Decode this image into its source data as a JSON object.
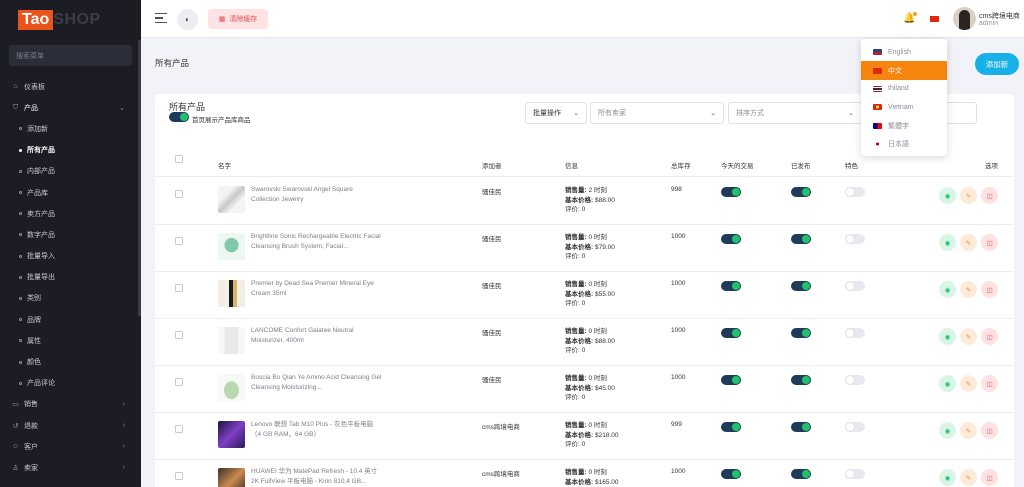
{
  "brand": {
    "part1": "Tao",
    "part2": "SHOP"
  },
  "sidebar": {
    "search_placeholder": "搜索菜单",
    "items": [
      {
        "label": "仪表板",
        "icon": "home-icon"
      },
      {
        "label": "产品",
        "icon": "cart-icon",
        "open": true
      },
      {
        "label": "添加新",
        "sub": true
      },
      {
        "label": "所有产品",
        "sub": true,
        "active": true
      },
      {
        "label": "内部产品",
        "sub": true
      },
      {
        "label": "产品库",
        "sub": true
      },
      {
        "label": "卖方产品",
        "sub": true
      },
      {
        "label": "数字产品",
        "sub": true
      },
      {
        "label": "批量导入",
        "sub": true
      },
      {
        "label": "批量导出",
        "sub": true
      },
      {
        "label": "类别",
        "sub": true
      },
      {
        "label": "品牌",
        "sub": true
      },
      {
        "label": "属性",
        "sub": true
      },
      {
        "label": "颜色",
        "sub": true
      },
      {
        "label": "产品评论",
        "sub": true
      },
      {
        "label": "销售",
        "icon": "money-icon",
        "chevron": true
      },
      {
        "label": "退款",
        "icon": "refund-icon",
        "chevron": true
      },
      {
        "label": "客户",
        "icon": "customer-icon",
        "chevron": true
      },
      {
        "label": "卖家",
        "icon": "seller-icon",
        "chevron": true
      }
    ]
  },
  "header": {
    "clear_cache_label": "清除缓存",
    "user_name": "cms跨境电商",
    "user_role": "admin"
  },
  "page": {
    "title": "所有产品",
    "add_button": "添加新"
  },
  "card": {
    "title": "所有产品",
    "toggle_label": "首页展示产品库商品",
    "bulk_action": "批量操作",
    "seller_placeholder": "所有卖家",
    "sort_placeholder": "排序方式"
  },
  "table": {
    "columns": {
      "name": "名字",
      "added_by": "添加者",
      "info": "信息",
      "stock": "总库存",
      "today_deal": "今天的交易",
      "published": "已发布",
      "featured": "特色",
      "options": "选项"
    },
    "info_labels": {
      "sold": "销售量:",
      "base_price": "基本价格:",
      "rating": "评价:"
    },
    "rows": [
      {
        "name": "Swarovski Swarovski Angel Square Collection Jewelry",
        "added_by": "骚佳民",
        "sold": "2 时刻",
        "price": "$88.00",
        "rating": "0",
        "stock": "998",
        "today_deal": true,
        "published": true,
        "featured": false,
        "img": "jewelry"
      },
      {
        "name": "Brightline Sonic Rechargeable Electric Facial Cleansing Brush System, Facial...",
        "added_by": "骚佳民",
        "sold": "0 时刻",
        "price": "$79.00",
        "rating": "0",
        "stock": "1000",
        "today_deal": true,
        "published": true,
        "featured": false,
        "img": "brush"
      },
      {
        "name": "Premier by Dead Sea Premier Mineral Eye Cream 35ml",
        "added_by": "骚佳民",
        "sold": "0 时刻",
        "price": "$55.00",
        "rating": "0",
        "stock": "1000",
        "today_deal": true,
        "published": true,
        "featured": false,
        "img": "cream"
      },
      {
        "name": "LANCOME Confort Galatee Neutral Moisturizer, 400ml",
        "added_by": "骚佳民",
        "sold": "0 时刻",
        "price": "$88.00",
        "rating": "0",
        "stock": "1000",
        "today_deal": true,
        "published": true,
        "featured": false,
        "img": "lancome"
      },
      {
        "name": "Boscia Bo Qian Ye Amino Acid Cleansing Gel Cleansing Moisturizing...",
        "added_by": "骚佳民",
        "sold": "0 时刻",
        "price": "$45.00",
        "rating": "0",
        "stock": "1000",
        "today_deal": true,
        "published": true,
        "featured": false,
        "img": "boscia"
      },
      {
        "name": "Lenovo 联想 Tab M10 Plus - 灰色平板电脑（4 GB RAM，64 GB）",
        "added_by": "cms跨境电商",
        "sold": "0 时刻",
        "price": "$218.00",
        "rating": "0",
        "stock": "999",
        "today_deal": true,
        "published": true,
        "featured": false,
        "img": "lenovo"
      },
      {
        "name": "HUAWEI 华为 MatePad Refresh - 10.4 英寸 2K FullView 平板电脑 - Kirin 810,4 GB...",
        "added_by": "cms跨境电商",
        "sold": "0 时刻",
        "price": "$165.00",
        "rating": "0",
        "stock": "1000",
        "today_deal": true,
        "published": true,
        "featured": false,
        "img": "huawei"
      }
    ]
  },
  "languages": [
    {
      "label": "English",
      "flag": "us-flag"
    },
    {
      "label": "中文",
      "flag": "cn-flag",
      "selected": true
    },
    {
      "label": "thiland",
      "flag": "th-flag"
    },
    {
      "label": "Vietnam",
      "flag": "vn-flag"
    },
    {
      "label": "繁體字",
      "flag": "tw-flag"
    },
    {
      "label": "日本語",
      "flag": "jp-flag"
    }
  ],
  "colors": {
    "brand": "#e8541a",
    "accent": "#17b0e8",
    "toggle_on": "#22c26a",
    "lang_selected": "#f5850e",
    "sidebar_bg": "#1b1c24"
  }
}
